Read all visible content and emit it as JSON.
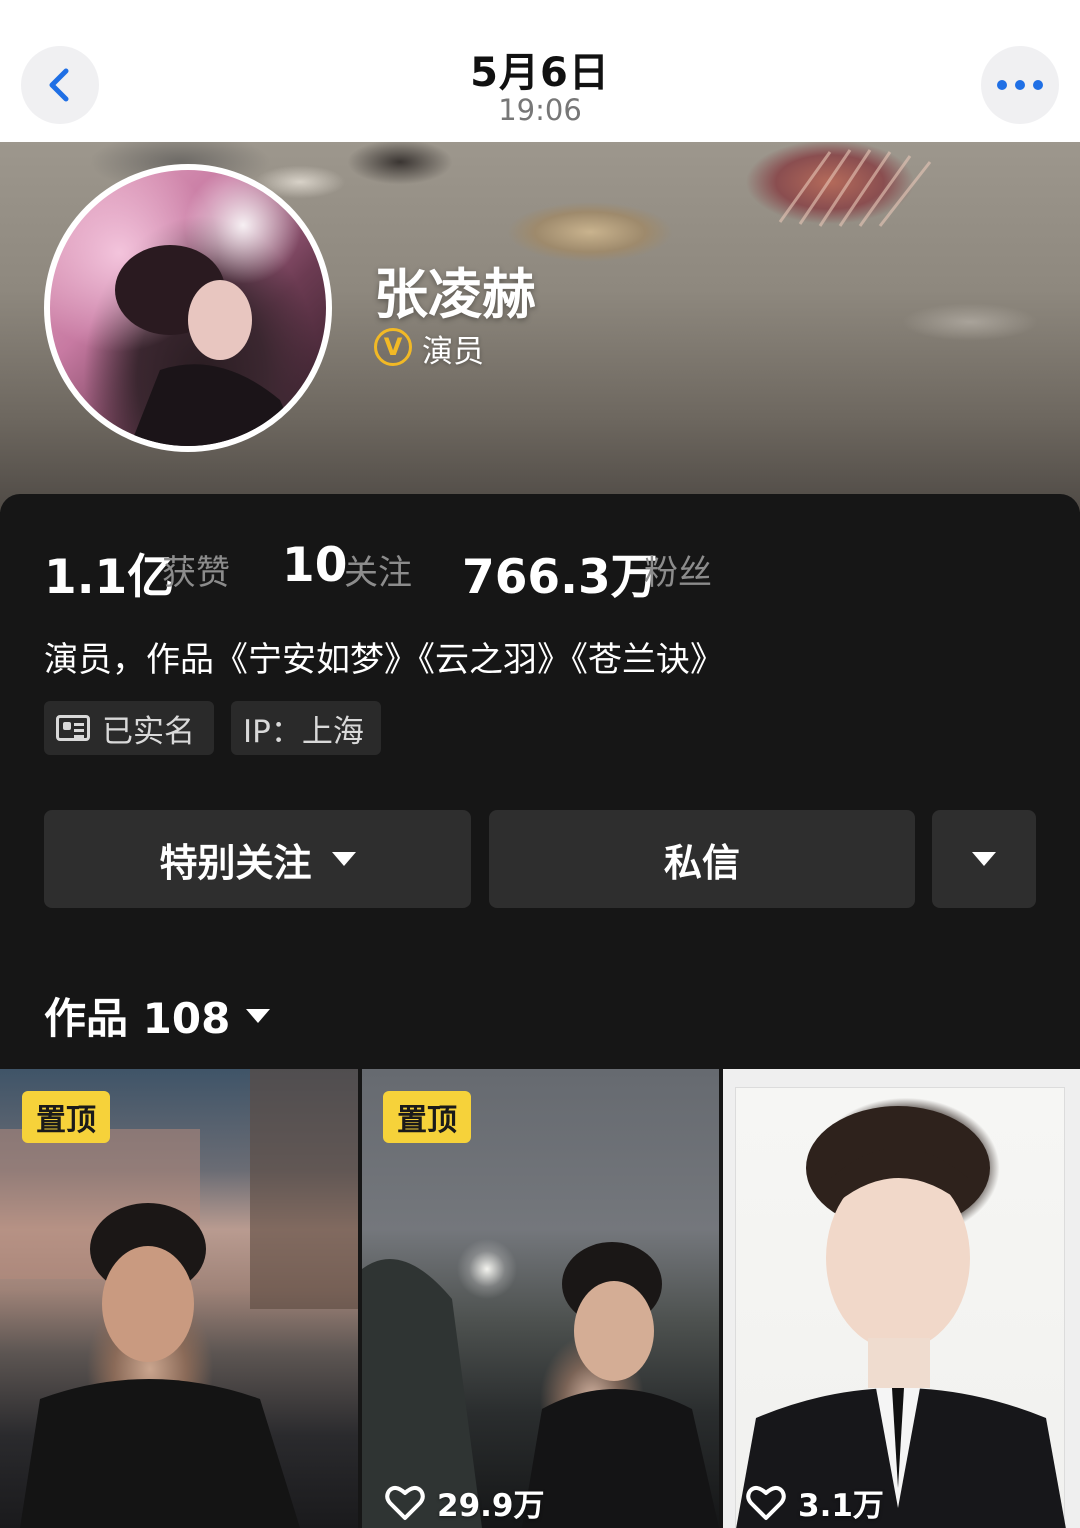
{
  "header": {
    "date": "5月6日",
    "time": "19:06"
  },
  "profile": {
    "name": "张凌赫",
    "verified_role": "演员",
    "verified_icon": "verified-v-icon",
    "stats": [
      {
        "value": "1.1亿",
        "label": "获赞"
      },
      {
        "value": "10",
        "label": "关注"
      },
      {
        "value": "766.3万",
        "label": "粉丝"
      }
    ],
    "bio": "演员，作品《宁安如梦》《云之羽》《苍兰诀》",
    "tags": {
      "real_name": "已实名",
      "ip": "IP：上海"
    }
  },
  "actions": {
    "follow_label": "特别关注",
    "message_label": "私信"
  },
  "works": {
    "title": "作品 108",
    "items": [
      {
        "pinned_label": "置顶",
        "likes": ""
      },
      {
        "pinned_label": "置顶",
        "likes": "29.9万"
      },
      {
        "pinned_label": "",
        "likes": "3.1万"
      }
    ]
  },
  "colors": {
    "accent_blue": "#1f6fe5",
    "pin_yellow": "#f6d23a",
    "verified_gold": "#f2b925",
    "card_bg": "#161616",
    "button_bg": "#2e2e2e"
  }
}
